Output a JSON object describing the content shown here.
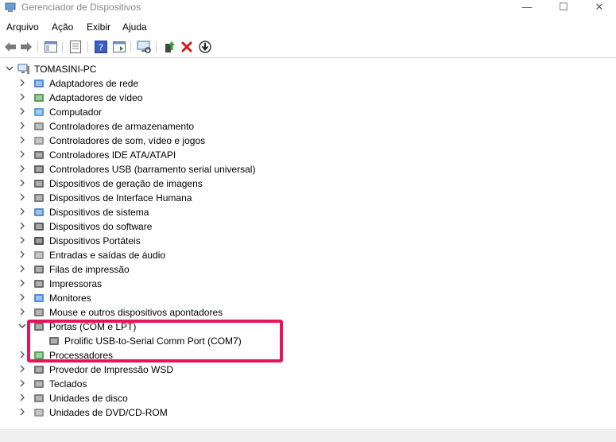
{
  "window": {
    "title": "Gerenciador de Dispositivos",
    "minimize": "—",
    "maximize": "☐",
    "close": "✕"
  },
  "menu": [
    "Arquivo",
    "Ação",
    "Exibir",
    "Ajuda"
  ],
  "tree": {
    "root": "TOMASINI-PC",
    "items": [
      {
        "label": "Adaptadores de rede",
        "icon": "network-adapter-icon",
        "color": "#2b7bd6"
      },
      {
        "label": "Adaptadores de vídeo",
        "icon": "display-adapter-icon",
        "color": "#3a8f3a"
      },
      {
        "label": "Computador",
        "icon": "computer-icon",
        "color": "#3a90d8"
      },
      {
        "label": "Controladores de armazenamento",
        "icon": "storage-controller-icon",
        "color": "#777777"
      },
      {
        "label": "Controladores de som, vídeo e jogos",
        "icon": "speaker-icon",
        "color": "#888888"
      },
      {
        "label": "Controladores IDE ATA/ATAPI",
        "icon": "ide-controller-icon",
        "color": "#555555"
      },
      {
        "label": "Controladores USB (barramento serial universal)",
        "icon": "usb-icon",
        "color": "#444444"
      },
      {
        "label": "Dispositivos de geração de imagens",
        "icon": "camera-icon",
        "color": "#555555"
      },
      {
        "label": "Dispositivos de Interface Humana",
        "icon": "hid-icon",
        "color": "#666666"
      },
      {
        "label": "Dispositivos de sistema",
        "icon": "system-devices-icon",
        "color": "#3a7bbf"
      },
      {
        "label": "Dispositivos do software",
        "icon": "software-device-icon",
        "color": "#444444"
      },
      {
        "label": "Dispositivos Portáteis",
        "icon": "portable-device-icon",
        "color": "#333333"
      },
      {
        "label": "Entradas e saídas de áudio",
        "icon": "audio-io-icon",
        "color": "#888888"
      },
      {
        "label": "Filas de impressão",
        "icon": "print-queue-icon",
        "color": "#555555"
      },
      {
        "label": "Impressoras",
        "icon": "printer-icon",
        "color": "#555555"
      },
      {
        "label": "Monitores",
        "icon": "monitor-icon",
        "color": "#2b7bd6"
      },
      {
        "label": "Mouse e outros dispositivos apontadores",
        "icon": "mouse-icon",
        "color": "#666666"
      },
      {
        "label": "Portas (COM e LPT)",
        "icon": "port-icon",
        "color": "#555555",
        "expanded": true,
        "children": [
          {
            "label": "Prolific USB-to-Serial Comm Port (COM7)",
            "icon": "serial-port-icon",
            "color": "#555555"
          }
        ]
      },
      {
        "label": "Processadores",
        "icon": "processor-icon",
        "color": "#3a9a3a"
      },
      {
        "label": "Provedor de Impressão WSD",
        "icon": "wsd-printer-icon",
        "color": "#555555"
      },
      {
        "label": "Teclados",
        "icon": "keyboard-icon",
        "color": "#666666"
      },
      {
        "label": "Unidades de disco",
        "icon": "disk-drive-icon",
        "color": "#666666"
      },
      {
        "label": "Unidades de DVD/CD-ROM",
        "icon": "dvd-drive-icon",
        "color": "#888888"
      }
    ]
  },
  "highlight_color": "#e8145a"
}
